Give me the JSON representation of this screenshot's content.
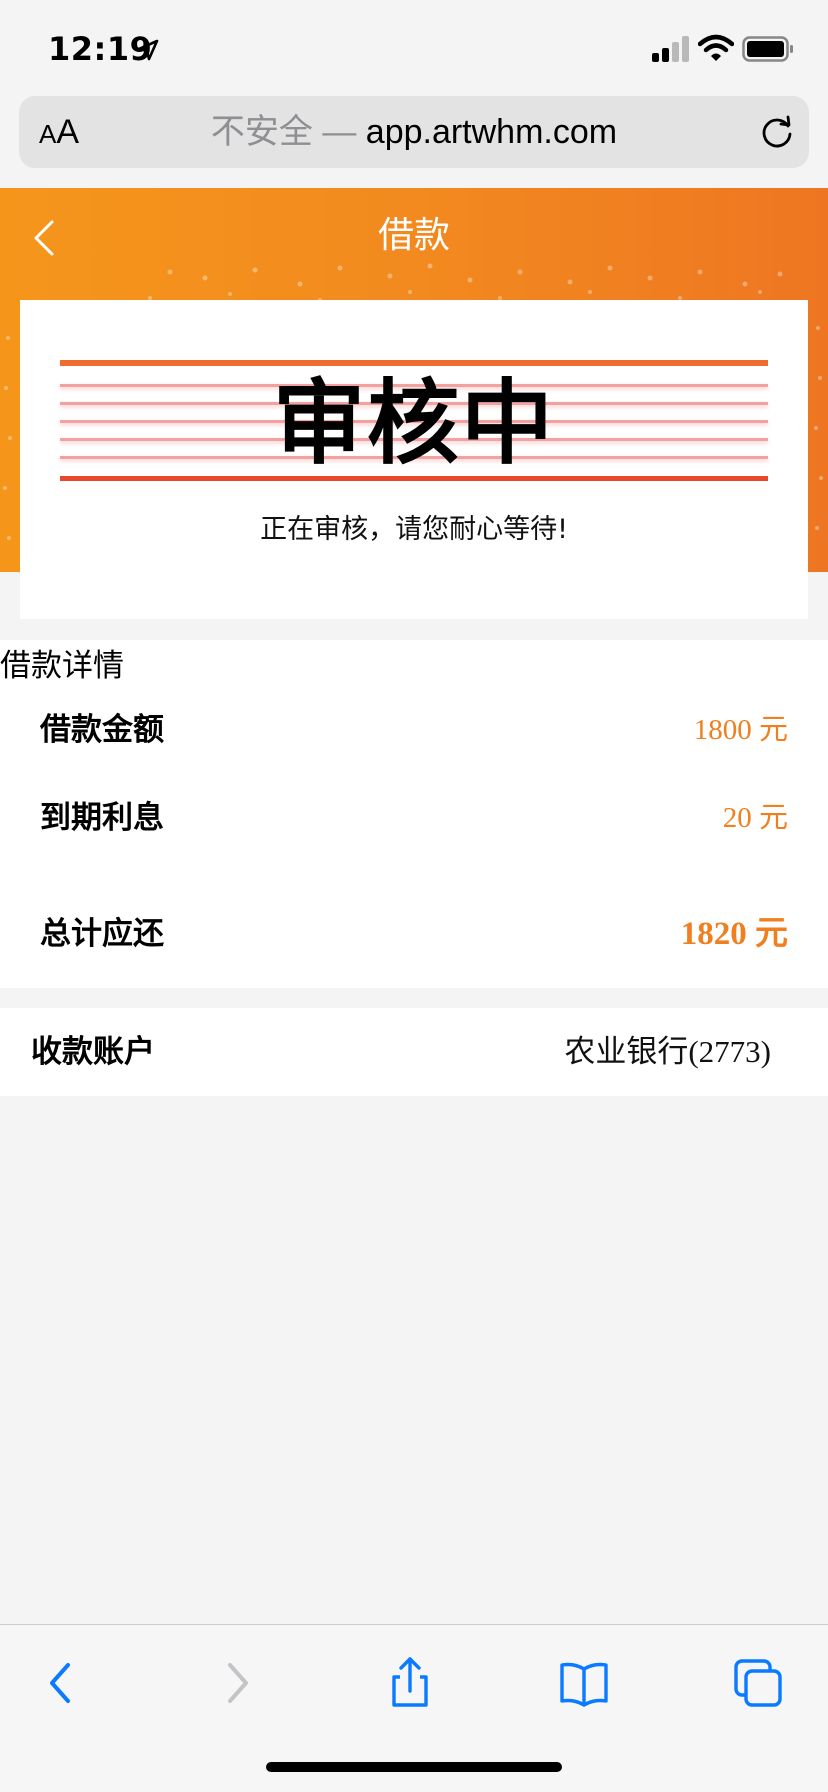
{
  "status_bar": {
    "time": "12:19",
    "icons": [
      "location-arrow-icon",
      "cellular-signal-icon",
      "wifi-icon",
      "battery-icon"
    ]
  },
  "browser": {
    "text_size_small": "A",
    "text_size_big": "A",
    "insecure_label": "不安全",
    "separator": "—",
    "host": "app.artwhm.com",
    "icons": [
      "reload-icon"
    ]
  },
  "header": {
    "title": "借款",
    "icons": [
      "back-chevron-icon"
    ]
  },
  "review": {
    "title": "审核中",
    "subtitle": "正在审核，请您耐心等待!"
  },
  "details": {
    "heading": "借款详情",
    "rows": [
      {
        "label": "借款金额",
        "value": "1800 元"
      },
      {
        "label": "到期利息",
        "value": "20 元"
      },
      {
        "label": "总计应还",
        "value": "1820 元"
      }
    ]
  },
  "account": {
    "label": "收款账户",
    "value": "农业银行(2773)"
  },
  "toolbar": {
    "icons": [
      "back-icon",
      "forward-icon",
      "share-icon",
      "bookmarks-icon",
      "tabs-icon"
    ]
  },
  "colors": {
    "accent": "#ef7f1f",
    "header_gradient_start": "#f5961b",
    "header_gradient_end": "#ee7622",
    "ios_blue": "#0a7aff",
    "stamp_red": "#e8472b"
  }
}
